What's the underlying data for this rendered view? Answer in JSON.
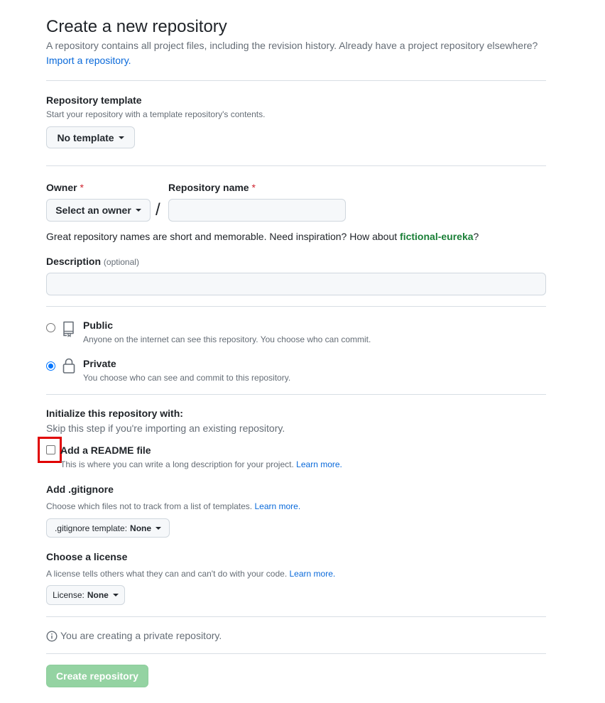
{
  "header": {
    "title": "Create a new repository",
    "description": "A repository contains all project files, including the revision history. Already have a project repository elsewhere?",
    "import_link": "Import a repository."
  },
  "template": {
    "label": "Repository template",
    "note": "Start your repository with a template repository's contents.",
    "button_label": "No template"
  },
  "owner": {
    "label": "Owner",
    "required_mark": "*",
    "button_label": "Select an owner",
    "separator": "/"
  },
  "repo_name": {
    "label": "Repository name",
    "required_mark": "*",
    "value": "",
    "hint_prefix": "Great repository names are short and memorable. Need inspiration? How about",
    "suggestion": "fictional-eureka",
    "hint_suffix": "?"
  },
  "description": {
    "label": "Description",
    "optional": "(optional)",
    "value": ""
  },
  "visibility": {
    "public": {
      "label": "Public",
      "note": "Anyone on the internet can see this repository. You choose who can commit.",
      "checked": false
    },
    "private": {
      "label": "Private",
      "note": "You choose who can see and commit to this repository.",
      "checked": true
    }
  },
  "initialize": {
    "heading": "Initialize this repository with:",
    "note": "Skip this step if you're importing an existing repository.",
    "readme": {
      "label": "Add a README file",
      "note": "This is where you can write a long description for your project.",
      "learn_more": "Learn more."
    }
  },
  "gitignore": {
    "label": "Add .gitignore",
    "note": "Choose which files not to track from a list of templates.",
    "learn_more": "Learn more.",
    "button_prefix": ".gitignore template:",
    "button_value": "None"
  },
  "license": {
    "label": "Choose a license",
    "note": "A license tells others what they can and can't do with your code.",
    "learn_more": "Learn more.",
    "button_prefix": "License:",
    "button_value": "None"
  },
  "info": {
    "text": "You are creating a private repository."
  },
  "submit": {
    "label": "Create repository"
  },
  "colors": {
    "link": "#0969da",
    "required": "#cf222e",
    "suggestion": "#1a7f37",
    "create_button_disabled": "#94d3a2",
    "highlight": "#e00000"
  }
}
